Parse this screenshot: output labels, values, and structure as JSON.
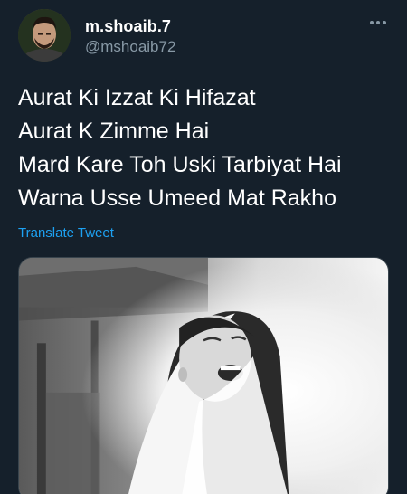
{
  "user": {
    "display_name": "m.shoaib.7",
    "handle": "@mshoaib72"
  },
  "tweet": {
    "lines": [
      "Aurat Ki Izzat Ki Hifazat",
      "Aurat K Zimme Hai",
      "Mard Kare Toh Uski Tarbiyat Hai",
      "Warna Usse Umeed Mat Rakho"
    ],
    "translate_label": "Translate Tweet"
  },
  "icons": {
    "more": "more-horizontal-icon"
  },
  "colors": {
    "background": "#15202b",
    "text": "#ffffff",
    "secondary_text": "#8899a6",
    "link": "#1da1f2"
  }
}
